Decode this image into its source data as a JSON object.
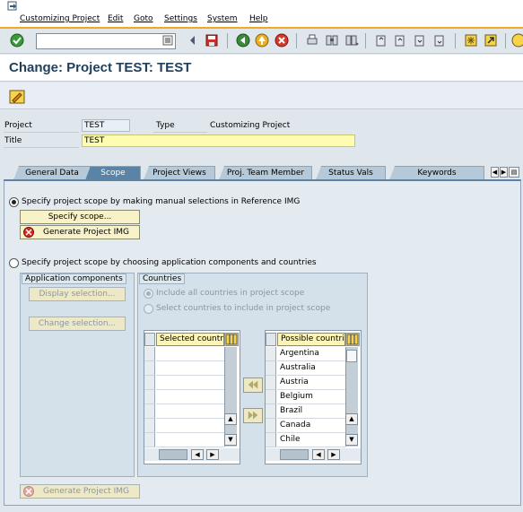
{
  "menu": {
    "items": [
      "Customizing Project",
      "Edit",
      "Goto",
      "Settings",
      "System",
      "Help"
    ]
  },
  "toolbar": {
    "command_field_value": "",
    "icons": [
      "check-icon",
      "history-dropdown-icon",
      "nav-left-icon",
      "save-icon",
      "back-icon",
      "exit-icon",
      "cancel-icon",
      "print-icon",
      "find-icon",
      "find-next-icon",
      "first-page-icon",
      "prev-page-icon",
      "next-page-icon",
      "last-page-icon",
      "new-session-icon",
      "shortcut-icon",
      "help-icon"
    ]
  },
  "title": "Change: Project TEST: TEST",
  "header": {
    "project_label": "Project",
    "project_value": "TEST",
    "type_label": "Type",
    "type_value": "Customizing Project",
    "title_label": "Title",
    "title_value": "TEST"
  },
  "tabs": [
    {
      "label": "General Data",
      "active": false
    },
    {
      "label": "Scope",
      "active": true
    },
    {
      "label": "Project Views",
      "active": false
    },
    {
      "label": "Proj. Team Member",
      "active": false
    },
    {
      "label": "Status Vals",
      "active": false
    },
    {
      "label": "Keywords",
      "active": false
    }
  ],
  "scope": {
    "option_manual": "Specify project scope by making manual selections in Reference IMG",
    "option_manual_selected": true,
    "specify_scope_button": "Specify scope...",
    "generate_project_img_button": "Generate Project IMG",
    "option_components": "Specify project scope by choosing application components and countries",
    "option_components_selected": false,
    "app_components_title": "Application components",
    "display_selection_button": "Display selection...",
    "change_selection_button": "Change selection...",
    "countries_title": "Countries",
    "include_all_label": "Include all countries in project scope",
    "select_countries_label": "Select countries to include in project scope",
    "selected_countries_header": "Selected countri...",
    "possible_countries_header": "Possible countries",
    "possible_countries": [
      "Argentina",
      "Australia",
      "Austria",
      "Belgium",
      "Brazil",
      "Canada",
      "Chile"
    ],
    "generate_project_img_bottom": "Generate Project IMG"
  },
  "colors": {
    "menu_accent": "#f3a72a",
    "title_color": "#1f3f5e",
    "active_tab": "#5a83a6",
    "title_field_bg": "#fdfcb0"
  }
}
